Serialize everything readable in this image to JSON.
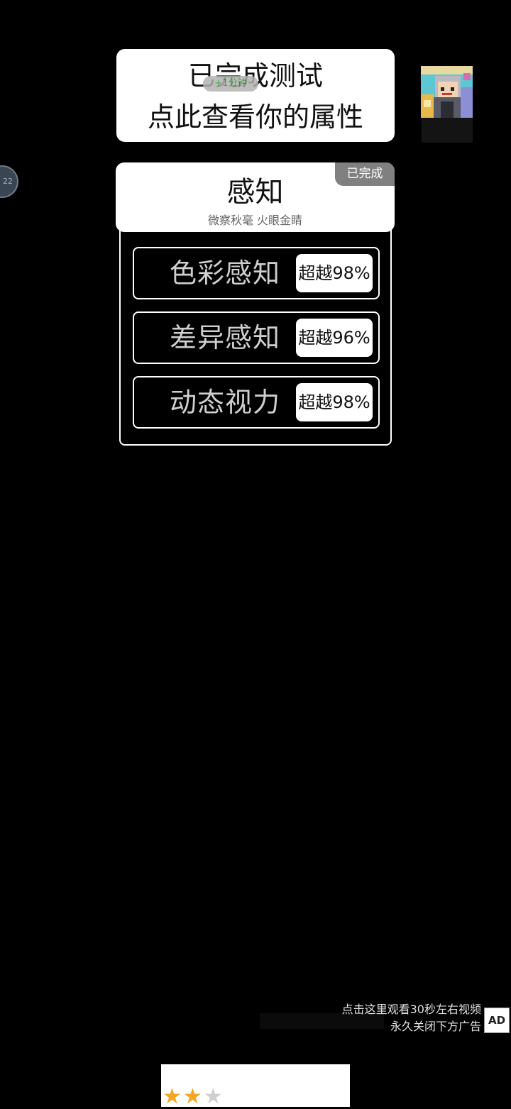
{
  "banner": {
    "line1": "已完成测试",
    "line2": "点此查看你的属性",
    "pill_text": "+1分钟"
  },
  "left_badge": {
    "text": "22"
  },
  "category": {
    "title": "感知",
    "subtitle": "微察秋毫 火眼金睛",
    "status": "已完成"
  },
  "results": [
    {
      "name": "色彩感知",
      "badge": "超越98%"
    },
    {
      "name": "差异感知",
      "badge": "超越96%"
    },
    {
      "name": "动态视力",
      "badge": "超越98%"
    }
  ],
  "ad": {
    "line1": "点击这里观看30秒左右视频",
    "line2": "永久关闭下方广告",
    "icon_label": "AD"
  },
  "rating": {
    "filled": 2,
    "total": 3,
    "star_glyph": "★"
  },
  "colors": {
    "background": "#000000",
    "card": "#ffffff",
    "tag": "#808080",
    "star": "#f4a623"
  }
}
